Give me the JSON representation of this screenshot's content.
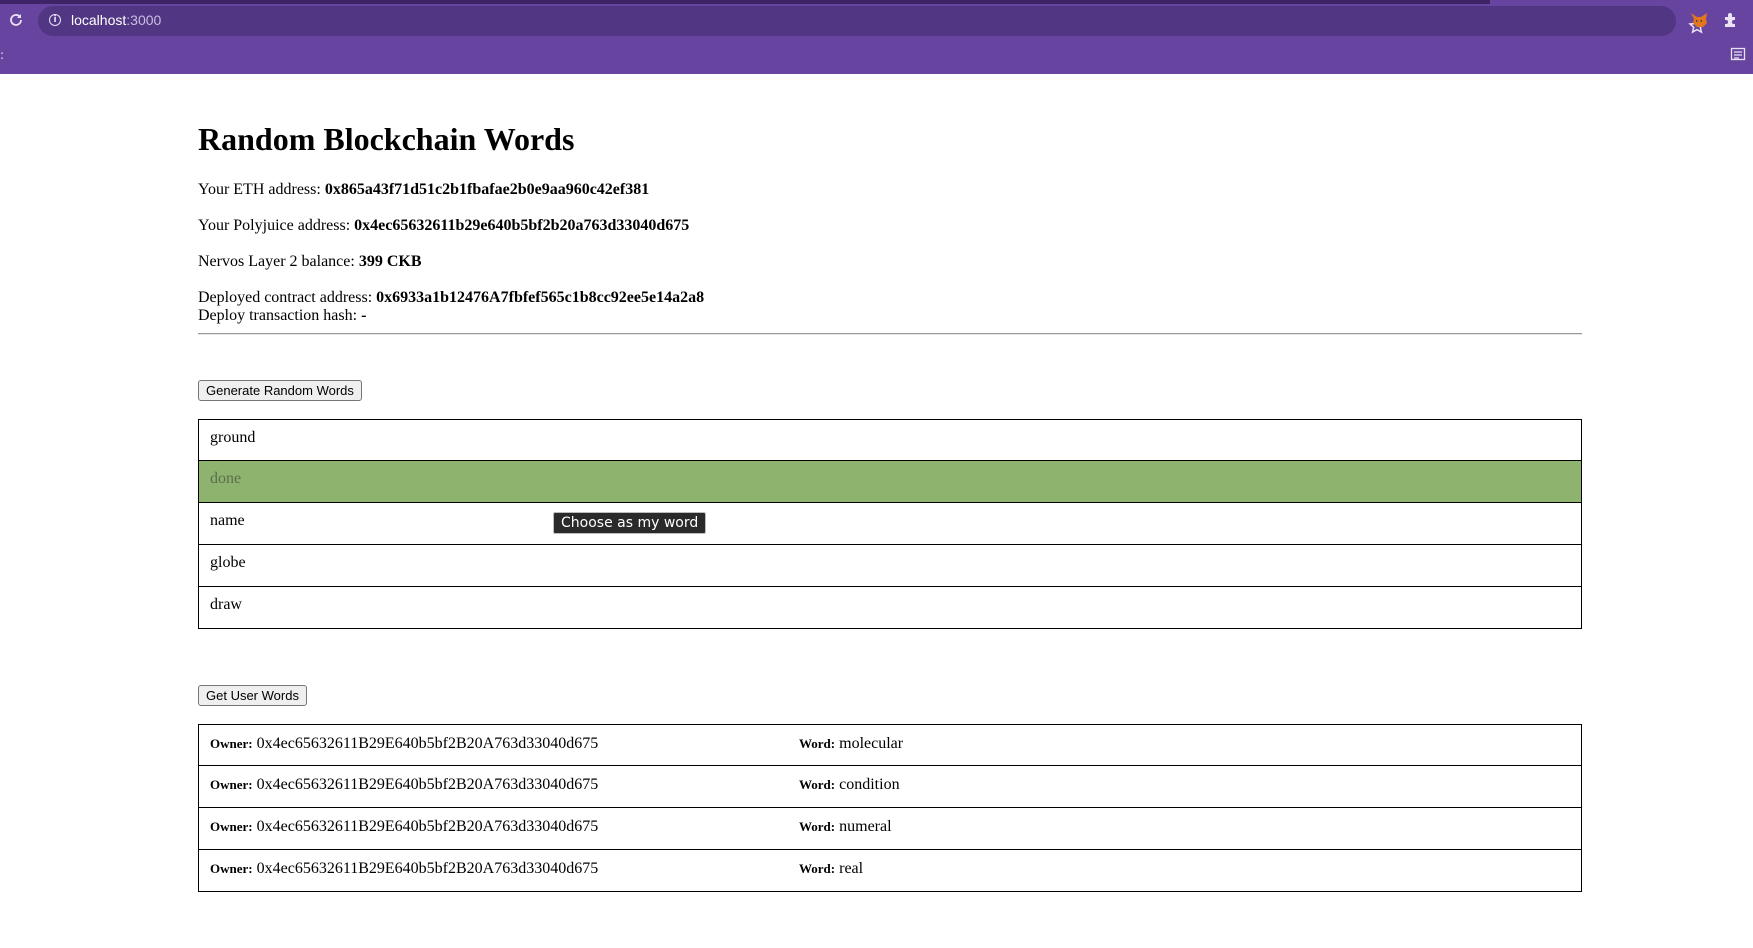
{
  "browser": {
    "url_host": "localhost",
    "url_port": ":3000"
  },
  "page": {
    "title": "Random Blockchain Words",
    "eth_label": "Your ETH address: ",
    "eth_value": "0x865a43f71d51c2b1fbafae2b0e9aa960c42ef381",
    "polyjuice_label": "Your Polyjuice address: ",
    "polyjuice_value": "0x4ec65632611b29e640b5bf2b20a763d33040d675",
    "balance_label": "Nervos Layer 2 balance: ",
    "balance_value": "399 CKB",
    "contract_label": "Deployed contract address: ",
    "contract_value": "0x6933a1b12476A7fbfef565c1b8cc92ee5e14a2a8",
    "deploy_tx_label": "Deploy transaction hash: ",
    "deploy_tx_value": "-"
  },
  "random_words": {
    "button_label": "Generate Random Words",
    "words": [
      "ground",
      "done",
      "name",
      "globe",
      "draw"
    ],
    "selected_index": 1,
    "tooltip": "Choose as my word"
  },
  "user_words": {
    "button_label": "Get User Words",
    "owner_label": "Owner:",
    "word_label": "Word:",
    "rows": [
      {
        "owner": "0x4ec65632611B29E640b5bf2B20A763d33040d675",
        "word": "molecular"
      },
      {
        "owner": "0x4ec65632611B29E640b5bf2B20A763d33040d675",
        "word": "condition"
      },
      {
        "owner": "0x4ec65632611B29E640b5bf2B20A763d33040d675",
        "word": "numeral"
      },
      {
        "owner": "0x4ec65632611B29E640b5bf2B20A763d33040d675",
        "word": "real"
      }
    ]
  },
  "colors": {
    "chrome": "#6644a0",
    "selected_row": "#8db36e"
  }
}
